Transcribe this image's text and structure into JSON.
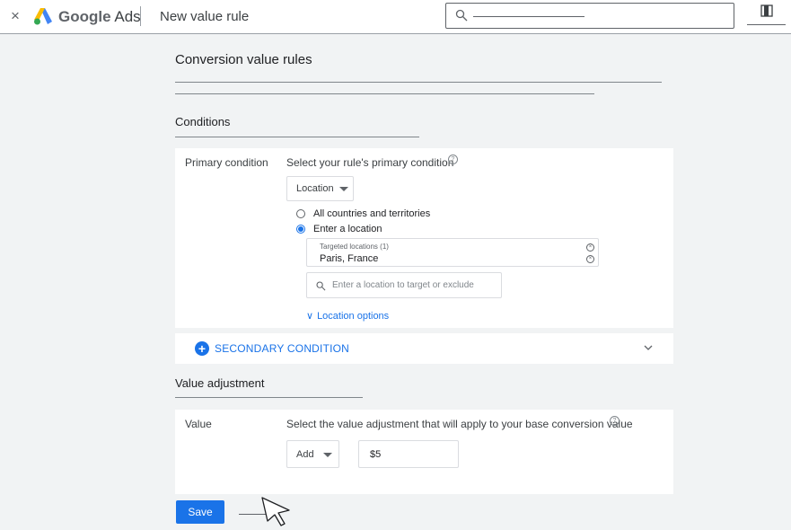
{
  "header": {
    "close_glyph": "×",
    "brand_google": "Google",
    "brand_ads": "Ads",
    "page_title": "New value rule",
    "icons": [
      "close-icon",
      "google-ads-logo-icon",
      "search-icon",
      "panel-icon"
    ]
  },
  "main": {
    "section_title": "Conversion value rules",
    "conditions_title": "Conditions",
    "primary": {
      "label": "Primary condition",
      "prompt": "Select your rule's primary condition",
      "help_glyph": "?",
      "dropdown_value": "Location",
      "radios": [
        {
          "label": "All countries and territories",
          "selected": false
        },
        {
          "label": "Enter a location",
          "selected": true
        }
      ],
      "targeted_caption": "Targeted locations (1)",
      "targeted_value": "Paris, France",
      "remove_glyph": "×",
      "search_placeholder": "Enter a location to target or exclude",
      "location_options": "Location options",
      "chevron_glyph": "∨"
    },
    "secondary": {
      "plus_glyph": "+",
      "label": "SECONDARY CONDITION"
    },
    "value_title": "Value adjustment",
    "value": {
      "label": "Value",
      "prompt": "Select the value adjustment that will apply to your base conversion value",
      "help_glyph": "?",
      "dropdown_value": "Add",
      "amount": "$5"
    },
    "save_label": "Save"
  },
  "colors": {
    "accent": "#1a73e8",
    "background": "#f1f3f4",
    "card": "#ffffff"
  }
}
